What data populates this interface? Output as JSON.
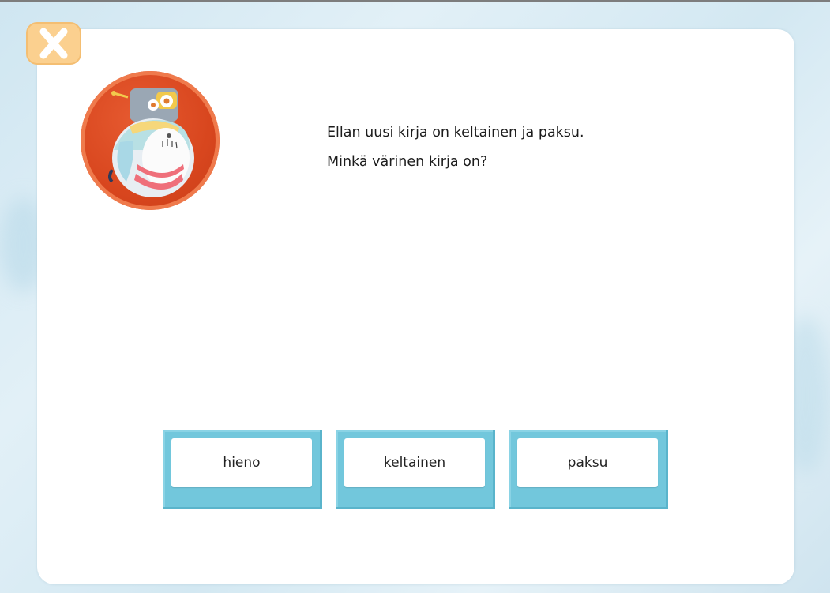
{
  "question": {
    "line1": "Ellan uusi kirja on keltainen ja paksu.",
    "line2": "Minkä värinen kirja on?"
  },
  "answers": [
    {
      "label": "hieno"
    },
    {
      "label": "keltainen"
    },
    {
      "label": "paksu"
    }
  ],
  "icons": {
    "close": "close-icon",
    "avatar": "robot-avatar-icon"
  },
  "colors": {
    "answer_tile": "#72c7dc",
    "close_button": "#fbd08f",
    "avatar_ring": "#d8461e"
  }
}
